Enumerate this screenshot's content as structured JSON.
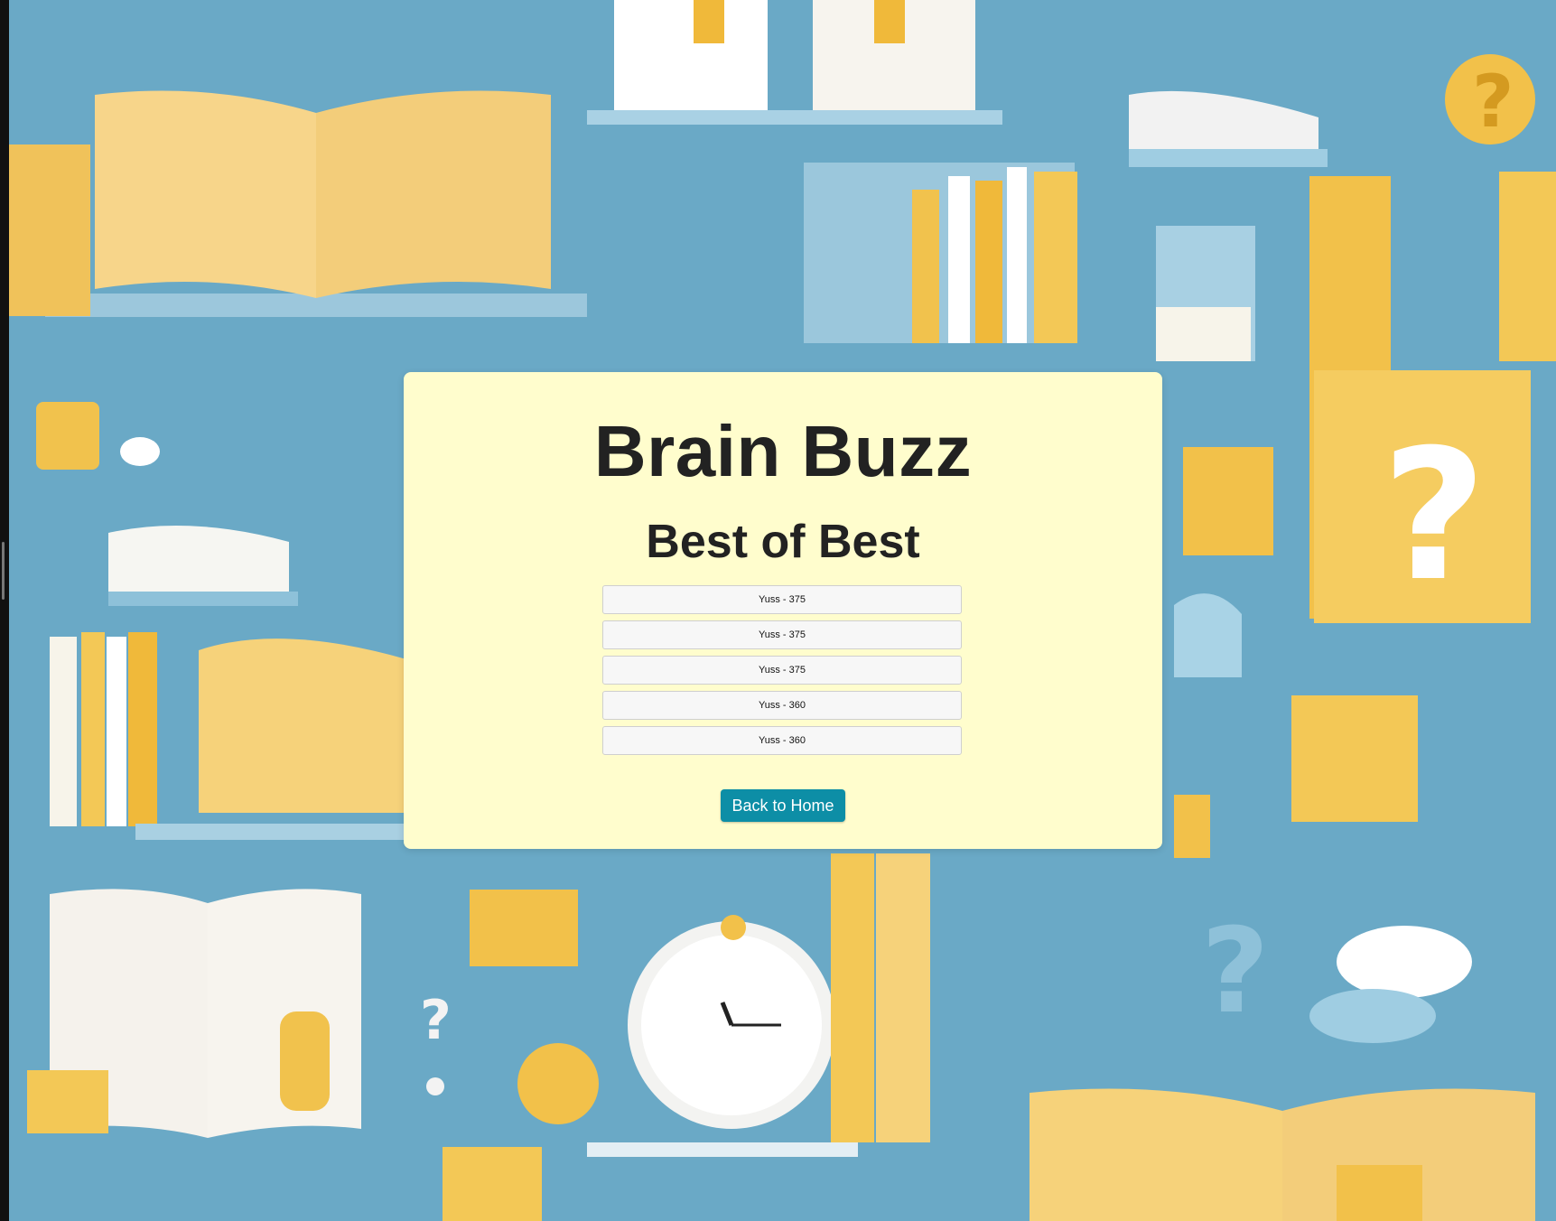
{
  "app": {
    "title": "Brain Buzz",
    "subtitle": "Best of Best"
  },
  "leaderboard": {
    "entries": [
      "Yuss - 375",
      "Yuss - 375",
      "Yuss - 375",
      "Yuss - 360",
      "Yuss - 360"
    ]
  },
  "actions": {
    "back_home_label": "Back to Home"
  },
  "colors": {
    "panel_background": "#fffdcd",
    "page_background": "#6aa9c6",
    "button_accent": "#0d8ea6",
    "illustration_yellow": "#f2c94c"
  },
  "icons": {
    "background": "books-clock-question-marks-illustration"
  }
}
